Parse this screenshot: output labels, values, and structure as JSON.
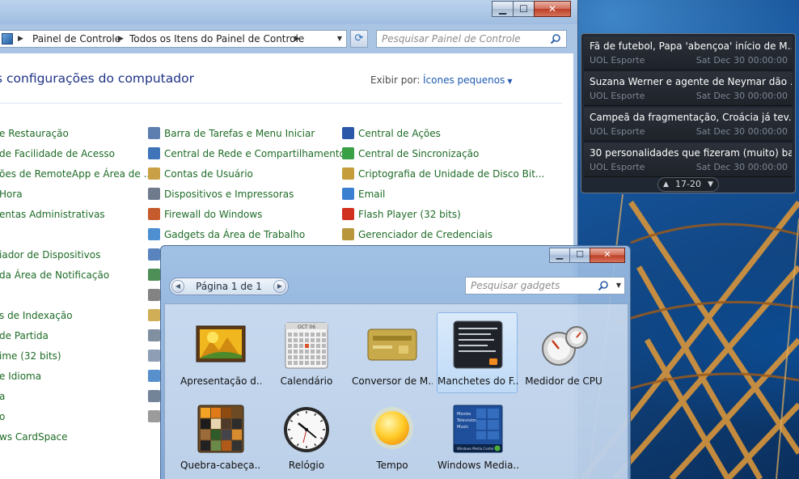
{
  "control_panel": {
    "title_fragment": "",
    "caption": {
      "minimize": "▁",
      "maximize": "☐",
      "close": "✕"
    },
    "breadcrumb": [
      "Painel de Controle",
      "Todos os Itens do Painel de Controle"
    ],
    "search_placeholder": "Pesquisar Painel de Controle",
    "heading": "s configurações do computador",
    "view_by_label": "Exibir por:",
    "view_by_value": "Ícones pequenos",
    "column1": [
      "e Restauração",
      "de Facilidade de Acesso",
      "ões de RemoteApp e Área de ...",
      "Hora",
      "entas Administrativas",
      "",
      "iador de Dispositivos",
      "da Área de Notificação",
      "",
      "s de Indexação",
      "de Partida",
      "ime (32 bits)",
      "e Idioma",
      "a",
      "o",
      "ws CardSpace"
    ],
    "column2": [
      "Barra de Tarefas e Menu Iniciar",
      "Central de Rede e Compartilhamento",
      "Contas de Usuário",
      "Dispositivos e Impressoras",
      "Firewall do Windows",
      "Gadgets da Área de Trabalho"
    ],
    "column3": [
      "Central de Ações",
      "Central de Sincronização",
      "Criptografia de Unidade de Disco Bit...",
      "Email",
      "Flash Player (32 bits)",
      "Gerenciador de Credenciais"
    ],
    "icon_colors": {
      "column2": [
        "#5c7fb0",
        "#3f74b8",
        "#c9a046",
        "#6f7b8c",
        "#c65b2e",
        "#4d8fd1"
      ],
      "column3": [
        "#2b57a8",
        "#39a046",
        "#c59d3a",
        "#3b7fd0",
        "#d0301e",
        "#b8963c"
      ]
    }
  },
  "news_gadget": {
    "items": [
      {
        "title": "Fã de futebol, Papa 'abençoa' início de M...",
        "source": "UOL Esporte",
        "date": "Sat Dec 30 00:00:00"
      },
      {
        "title": "Suzana Werner e agente de Neymar dão ...",
        "source": "UOL Esporte",
        "date": "Sat Dec 30 00:00:00"
      },
      {
        "title": "Campeã da fragmentação, Croácia já tev...",
        "source": "UOL Esporte",
        "date": "Sat Dec 30 00:00:00"
      },
      {
        "title": "30 personalidades que fizeram (muito) ba...",
        "source": "UOL Esporte",
        "date": "Sat Dec 30 00:00:00"
      }
    ],
    "pager": "17-20",
    "prev": "▲",
    "next": "▼"
  },
  "gadget_gallery": {
    "caption": {
      "minimize": "▁",
      "maximize": "☐",
      "close": "✕"
    },
    "page_label": "Página 1 de 1",
    "page_prev": "◀",
    "page_next": "▶",
    "search_placeholder": "Pesquisar gadgets",
    "search_dropdown": "▼",
    "calendar_month": "OCT 06",
    "gadgets": [
      {
        "label": "Apresentação d...",
        "icon": "slideshow-icon"
      },
      {
        "label": "Calendário",
        "icon": "calendar-icon"
      },
      {
        "label": "Conversor de M...",
        "icon": "currency-icon"
      },
      {
        "label": "Manchetes do F...",
        "icon": "feed-headlines-icon",
        "selected": true
      },
      {
        "label": "Medidor de CPU",
        "icon": "cpu-meter-icon"
      },
      {
        "label": "Quebra-cabeça...",
        "icon": "puzzle-icon"
      },
      {
        "label": "Relógio",
        "icon": "clock-icon"
      },
      {
        "label": "Tempo",
        "icon": "weather-icon"
      },
      {
        "label": "Windows Media...",
        "icon": "media-center-icon"
      }
    ],
    "media_center_lines": [
      "Movies",
      "Television",
      "Music"
    ],
    "media_center_brand": "Windows Media Center"
  }
}
